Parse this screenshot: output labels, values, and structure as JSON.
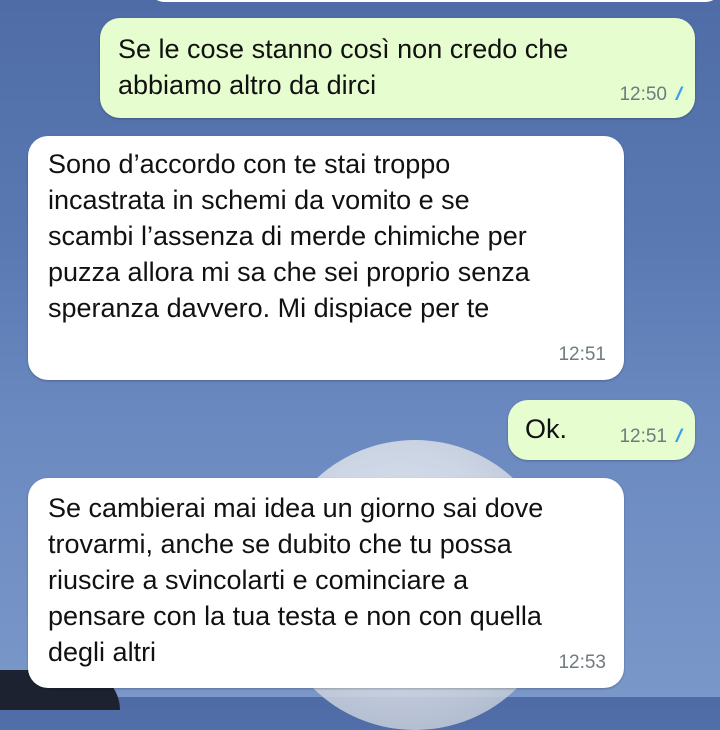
{
  "colors": {
    "outgoing_bubble": "#e6fdd0",
    "incoming_bubble": "#ffffff",
    "read_ticks": "#3e9cf0",
    "timestamp": "#6e7b80"
  },
  "messages": [
    {
      "direction": "outgoing",
      "text": "Se le cose stanno così non credo che\nabbiamo altro da dirci",
      "time": "12:50",
      "status_icon": "double-check-read-icon"
    },
    {
      "direction": "incoming",
      "text": "Sono d’accordo con te stai troppo\nincastrata in schemi da vomito e se\nscambi l’assenza di merde chimiche per\npuzza allora mi sa che sei proprio senza\nsperanza davvero. Mi dispiace per te",
      "time": "12:51"
    },
    {
      "direction": "outgoing",
      "text": "Ok.",
      "time": "12:51",
      "status_icon": "double-check-read-icon"
    },
    {
      "direction": "incoming",
      "text": "Se cambierai mai idea un giorno sai dove\ntrovarmi, anche se dubito che tu possa\nriuscire a svincolarti e cominciare a\npensare con la tua testa e non con quella\ndegli altri",
      "time": "12:53"
    }
  ]
}
